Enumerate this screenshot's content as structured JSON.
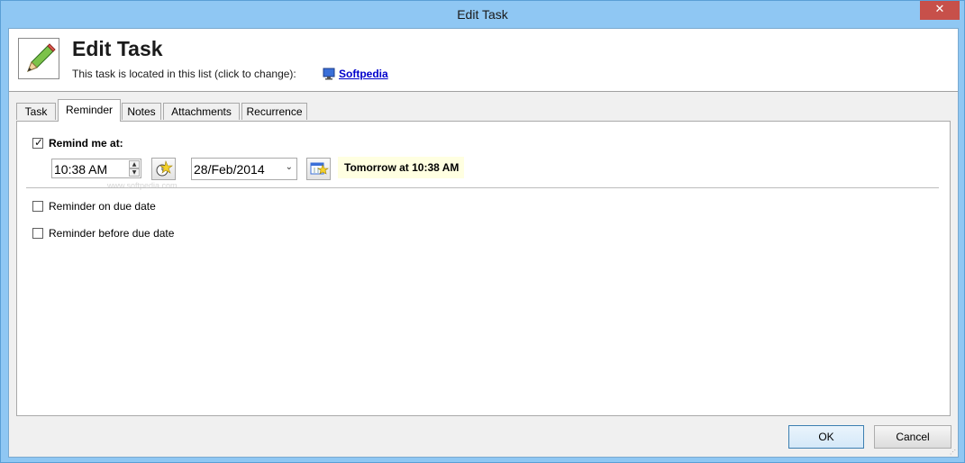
{
  "window": {
    "title": "Edit Task",
    "close_glyph": "✕"
  },
  "header": {
    "title": "Edit Task",
    "subtitle": "This task is located in this list (click to change):",
    "list_name": "Softpedia",
    "icon": "pencil-icon",
    "list_icon": "monitor-icon"
  },
  "tabs": [
    {
      "label": "Task",
      "active": false
    },
    {
      "label": "Reminder",
      "active": true
    },
    {
      "label": "Notes",
      "active": false
    },
    {
      "label": "Attachments",
      "active": false
    },
    {
      "label": "Recurrence",
      "active": false
    }
  ],
  "reminder": {
    "remind_at": {
      "label": "Remind me at:",
      "checked": true
    },
    "time": "10:38 AM",
    "date": "28/Feb/2014",
    "hint": "Tomorrow at 10:38 AM",
    "on_due": {
      "label": "Reminder on due date",
      "checked": false
    },
    "before_due": {
      "label": "Reminder before due date",
      "checked": false
    }
  },
  "watermark": "www.softpedia.com",
  "buttons": {
    "ok": "OK",
    "cancel": "Cancel"
  },
  "colors": {
    "titlebar": "#8fc7f3",
    "close": "#c7504a",
    "hint_bg": "#ffffe1",
    "link": "#0000cc"
  }
}
